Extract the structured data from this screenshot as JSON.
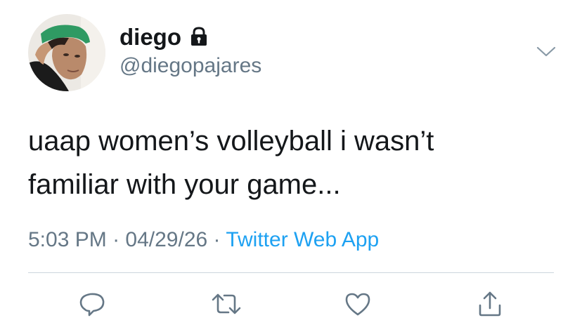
{
  "tweet": {
    "author": {
      "display_name": "diego",
      "handle": "@diegopajares",
      "protected": true
    },
    "text_lines": [
      "uaap women’s volleyball i wasn’t",
      "familiar with your game..."
    ],
    "time": "5:03 PM",
    "separator": "·",
    "date": "04/29/26",
    "source": "Twitter Web App",
    "actions": [
      "reply-icon",
      "retweet-icon",
      "like-icon",
      "share-icon"
    ]
  },
  "colors": {
    "text": "#14171a",
    "secondary": "#657786",
    "link": "#1da1f2",
    "divider": "#ccd6dd"
  }
}
